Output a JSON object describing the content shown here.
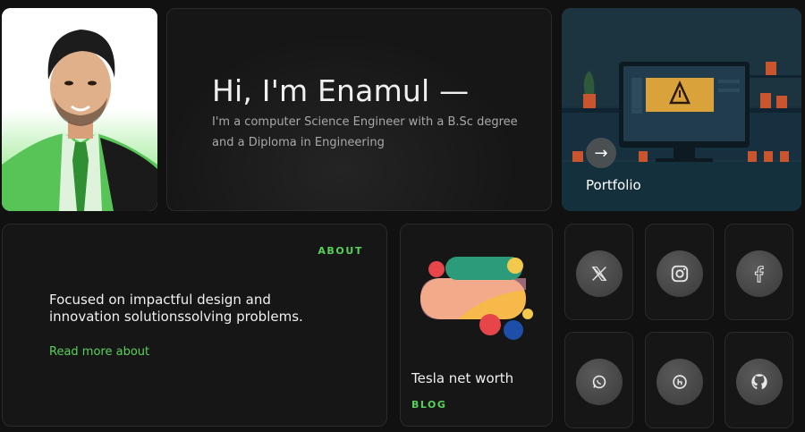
{
  "hero": {
    "title": "Hi, I'm Enamul —",
    "description": "I'm a computer Science Engineer with a B.Sc degree and a Diploma in Engineering"
  },
  "portfolio": {
    "label": "Portfolio",
    "arrow": "→",
    "screen_text": "Error"
  },
  "about": {
    "tag": "ABOUT",
    "text": "Focused on impactful design and innovation solutionssolving problems.",
    "link": "Read more about"
  },
  "blog": {
    "title": "Tesla net worth",
    "tag": "BLOG"
  },
  "social": [
    {
      "name": "x-icon"
    },
    {
      "name": "instagram-icon"
    },
    {
      "name": "facebook-icon"
    },
    {
      "name": "whatsapp-icon"
    },
    {
      "name": "hashnode-icon"
    },
    {
      "name": "github-icon"
    }
  ],
  "colors": {
    "background": "#111111",
    "card": "#161616",
    "accent": "#57d15a",
    "text": "#f0f0f0",
    "muted": "#a8a8a8"
  }
}
